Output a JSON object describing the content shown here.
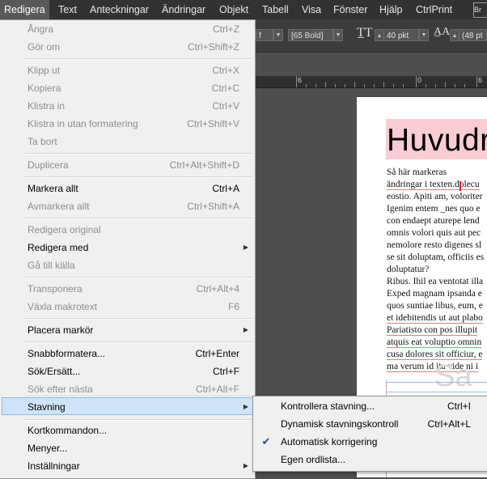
{
  "menubar": {
    "items": [
      "Redigera",
      "Text",
      "Anteckningar",
      "Ändringar",
      "Objekt",
      "Tabell",
      "Visa",
      "Fönster",
      "Hjälp",
      "CtrlPrint"
    ],
    "active": "Redigera",
    "app_switch": "Br"
  },
  "controlbar": {
    "font_size_partial": "f",
    "font_style": "[65 Bold]",
    "size_value": "40 pkt",
    "leading_value": "(48 pt"
  },
  "ruler": {
    "labels": [
      "6",
      "0",
      "6"
    ]
  },
  "document": {
    "headline": "Huvudr",
    "body_lines": [
      "Så här markeras",
      "ändringar i texten.dolecu",
      "eostio. Apiti am, voloriter",
      "Igenim entem _nes quo e",
      "con endaept aturepe lend",
      "omnis volori quis aut pec",
      "nemolore resto digenes sl",
      "se sit doluptam, officiis es",
      "doluptatur?",
      "Ribus. Ihil ea ventotat illa",
      "Exped magnam ipsanda e",
      "quos suntiae libus, eum, e",
      "et idebitendis ut aut plabo",
      "Pariatisto con pos illupit",
      "atquis eat voluptio omnin",
      "cusa dolores sit officiur, e",
      "ma verum id ita vide ni i"
    ],
    "ghost_text": "Sa"
  },
  "edit_menu": {
    "items": [
      {
        "label": "Ångra",
        "shortcut": "Ctrl+Z",
        "enabled": false
      },
      {
        "label": "Gör om",
        "shortcut": "Ctrl+Shift+Z",
        "enabled": false
      },
      {
        "label": "Klipp ut",
        "shortcut": "Ctrl+X",
        "enabled": false
      },
      {
        "label": "Kopiera",
        "shortcut": "Ctrl+C",
        "enabled": false
      },
      {
        "label": "Klistra in",
        "shortcut": "Ctrl+V",
        "enabled": false
      },
      {
        "label": "Klistra in utan formatering",
        "shortcut": "Ctrl+Shift+V",
        "enabled": false
      },
      {
        "label": "Ta bort",
        "shortcut": "",
        "enabled": false
      },
      {
        "label": "Duplicera",
        "shortcut": "Ctrl+Alt+Shift+D",
        "enabled": false
      },
      {
        "label": "Markera allt",
        "shortcut": "Ctrl+A",
        "enabled": true
      },
      {
        "label": "Avmarkera allt",
        "shortcut": "Ctrl+Shift+A",
        "enabled": false
      },
      {
        "label": "Redigera original",
        "shortcut": "",
        "enabled": false
      },
      {
        "label": "Redigera med",
        "shortcut": "",
        "enabled": true,
        "submenu": true
      },
      {
        "label": "Gå till källa",
        "shortcut": "",
        "enabled": false
      },
      {
        "label": "Transponera",
        "shortcut": "Ctrl+Alt+4",
        "enabled": false
      },
      {
        "label": "Växla makrotext",
        "shortcut": "F6",
        "enabled": false
      },
      {
        "label": "Placera markör",
        "shortcut": "",
        "enabled": true,
        "submenu": true
      },
      {
        "label": "Snabbformatera...",
        "shortcut": "Ctrl+Enter",
        "enabled": true
      },
      {
        "label": "Sök/Ersätt...",
        "shortcut": "Ctrl+F",
        "enabled": true
      },
      {
        "label": "Sök efter nästa",
        "shortcut": "Ctrl+Alt+F",
        "enabled": false
      },
      {
        "label": "Stavning",
        "shortcut": "",
        "enabled": true,
        "submenu": true,
        "highlighted": true
      },
      {
        "label": "Kortkommandon...",
        "shortcut": "",
        "enabled": true
      },
      {
        "label": "Menyer...",
        "shortcut": "",
        "enabled": true
      },
      {
        "label": "Inställningar",
        "shortcut": "",
        "enabled": true,
        "submenu": true
      }
    ]
  },
  "spelling_submenu": {
    "items": [
      {
        "label": "Kontrollera stavning...",
        "shortcut": "Ctrl+I",
        "checked": false
      },
      {
        "label": "Dynamisk stavningskontroll",
        "shortcut": "Ctrl+Alt+L",
        "checked": false
      },
      {
        "label": "Automatisk korrigering",
        "shortcut": "",
        "checked": true
      },
      {
        "label": "Egen ordlista...",
        "shortcut": "",
        "checked": false
      }
    ]
  },
  "colors": {
    "menubar_bg": "#323232",
    "menu_bg": "#f0f0f0",
    "highlight": "#cfe4f8",
    "headline_bg": "#f9cdd3",
    "disabled_text": "#8d8d8d"
  }
}
